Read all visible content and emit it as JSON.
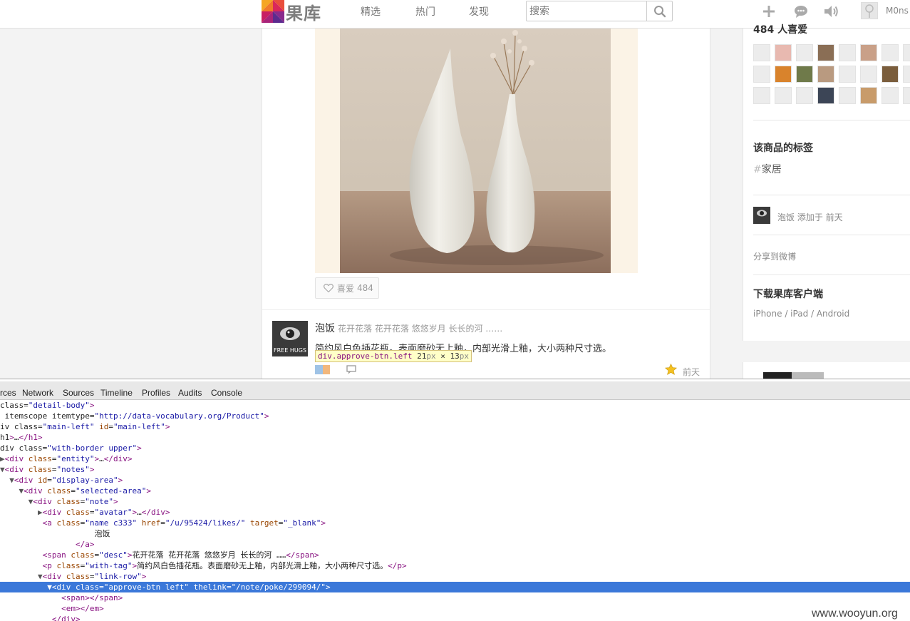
{
  "header": {
    "logo_text": "果库",
    "nav": [
      {
        "label": "精选"
      },
      {
        "label": "热门"
      },
      {
        "label": "发现"
      }
    ],
    "search": {
      "placeholder": "搜索"
    },
    "user_name": "M0ns"
  },
  "product": {
    "like_label": "喜爱",
    "like_count": "484"
  },
  "note": {
    "author": "泡饭",
    "desc": "花开花落 花开花落 悠悠岁月 长长的河 ……",
    "text": "简约风白色插花瓶。表面磨砂无上釉，内部光滑上釉，大小两种尺寸选。",
    "time": "前天",
    "tooltip": {
      "selector": "div.approve-btn.left",
      "w": "21",
      "unit": "px",
      "x": "×",
      "h": "13"
    }
  },
  "sidebar": {
    "likers_title": "484 人喜爱",
    "tags_title": "该商品的标签",
    "tag": {
      "hash": "#",
      "name": "家居"
    },
    "added_by": "泡饭 添加于 前天",
    "share": "分享到微博",
    "client_title": "下载果库客户端",
    "client_links": "iPhone / iPad / Android"
  },
  "devtools": {
    "tabs": [
      "rces",
      "Network",
      "Sources",
      "Timeline",
      "Profiles",
      "Audits",
      "Console"
    ],
    "lines": [
      "class=\"detail-body\">",
      " itemscope itemtype=\"http://data-vocabulary.org/Product\">",
      "iv class=\"main-left\" id=\"main-left\">",
      "h1>…</h1>",
      "div class=\"with-border upper\">",
      "▶<div class=\"entity\">…</div>",
      "▼<div class=\"notes\">",
      "  ▼<div id=\"display-area\">",
      "    ▼<div class=\"selected-area\">",
      "      ▼<div class=\"note\">",
      "        ▶<div class=\"avatar\">…</div>",
      "         <a class=\"name c333\" href=\"/u/95424/likes/\" target=\"_blank\">",
      "                    泡饭",
      "                </a>",
      "         <span class=\"desc\">花开花落 花开花落 悠悠岁月 长长的河 ……</span>",
      "         <p class=\"with-tag\">简约风白色插花瓶。表面磨砂无上釉，内部光滑上釉，大小两种尺寸选。</p>",
      "        ▼<div class=\"link-row\">",
      "          ▼<div class=\"approve-btn left\" thelink=\"/note/poke/299094/\">",
      "             <span></span>",
      "             <em></em>",
      "           </div>"
    ],
    "selected_line": 17
  },
  "watermark": "www.wooyun.org",
  "colors": {
    "selection": "#3b78d9",
    "tooltip_bg": "#ffffc8",
    "tag_purple": "#881280",
    "attr_brown": "#994500",
    "value_blue": "#1a1aa6"
  }
}
